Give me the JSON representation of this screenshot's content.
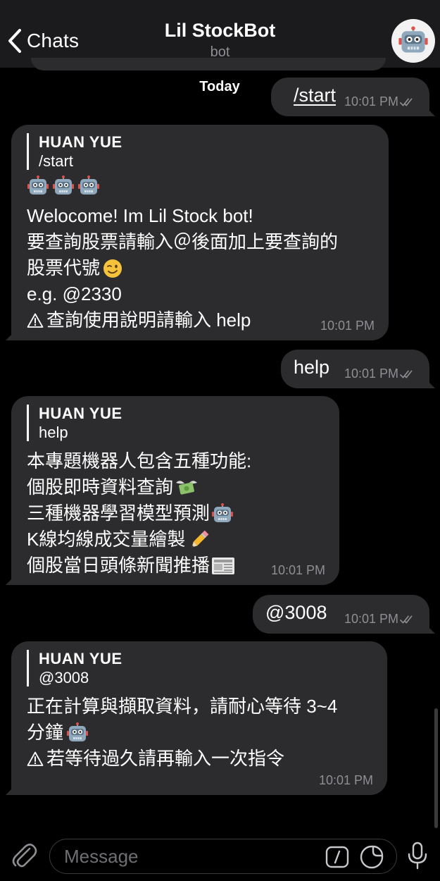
{
  "header": {
    "back_label": "Chats",
    "title": "Lil StockBot",
    "subtitle": "bot"
  },
  "chat": {
    "date_label": "Today",
    "messages": [
      {
        "direction": "out",
        "text": "/start",
        "time": "10:01 PM"
      },
      {
        "direction": "in",
        "reply_name": "HUAN YUE",
        "reply_text": "/start",
        "lines": [
          "Welocome! Im Lil Stock bot!",
          "要查詢股票請輸入＠後面加上要查詢的",
          "股票代號",
          "e.g. @2330",
          "查詢使用說明請輸入 help"
        ],
        "time": "10:01 PM"
      },
      {
        "direction": "out",
        "text": "help",
        "time": "10:01 PM"
      },
      {
        "direction": "in",
        "reply_name": "HUAN YUE",
        "reply_text": "help",
        "lines": [
          "本專題機器人包含五種功能:",
          "個股即時資料查詢",
          "三種機器學習模型預測",
          "K線均線成交量繪製",
          "個股當日頭條新聞推播"
        ],
        "time": "10:01 PM"
      },
      {
        "direction": "out",
        "text": "@3008",
        "time": "10:01 PM"
      },
      {
        "direction": "in",
        "reply_name": "HUAN YUE",
        "reply_text": "@3008",
        "lines": [
          "正在計算與擷取資料，請耐心等待 3~4",
          "分鐘",
          "若等待過久請再輸入一次指令"
        ],
        "time": "10:01 PM"
      }
    ]
  },
  "composer": {
    "placeholder": "Message"
  },
  "icons": {
    "back": "chevron-left-icon",
    "avatar": "robot-icon",
    "attach": "paperclip-icon",
    "commands": "slash-command-icon",
    "sticker": "sticker-icon",
    "mic": "microphone-icon",
    "read": "double-check-icon",
    "warning": "warning-icon",
    "robot": "robot-emoji",
    "money": "money-wings-emoji",
    "pencil": "pencil-emoji",
    "newspaper": "newspaper-emoji",
    "wink": "wink-emoji"
  },
  "colors": {
    "background": "#000000",
    "header": "#1b1b1d",
    "bubble": "#2c2c2e",
    "secondary_text": "#8e8e93"
  }
}
